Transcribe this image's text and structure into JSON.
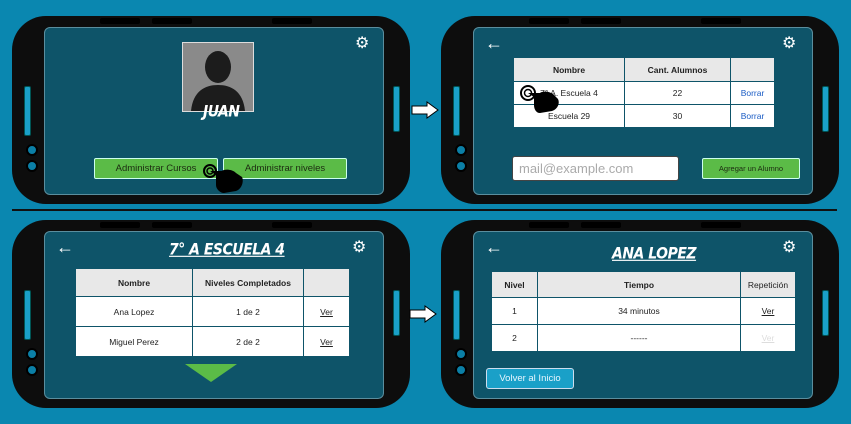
{
  "screen1": {
    "user_name": "JUAN",
    "btn_cursos": "Administrar Cursos",
    "btn_niveles": "Administrar niveles"
  },
  "screen2": {
    "headers": [
      "Nombre",
      "Cant. Alumnos",
      ""
    ],
    "rows": [
      {
        "nombre": "7° A. Escuela 4",
        "cant": "22",
        "accion": "Borrar"
      },
      {
        "nombre": "Escuela 29",
        "cant": "30",
        "accion": "Borrar"
      }
    ],
    "email_placeholder": "mail@example.com",
    "btn_agregar": "Agregar un Alumno"
  },
  "screen3": {
    "title": "7° A ESCUELA 4",
    "headers": [
      "Nombre",
      "Niveles Completados",
      ""
    ],
    "rows": [
      {
        "nombre": "Ana Lopez",
        "niveles": "1 de 2",
        "accion": "Ver"
      },
      {
        "nombre": "Miguel Perez",
        "niveles": "2 de 2",
        "accion": "Ver"
      }
    ]
  },
  "screen4": {
    "title": "ANA LOPEZ",
    "headers": [
      "Nivel",
      "Tiempo",
      "Repetición"
    ],
    "rows": [
      {
        "nivel": "1",
        "tiempo": "34 minutos",
        "accion": "Ver"
      },
      {
        "nivel": "2",
        "tiempo": "------",
        "accion": "Ver"
      }
    ],
    "btn_volver": "Volver al Inicio"
  },
  "icons": {
    "settings": "gear-icon",
    "back": "arrow-left-icon",
    "flow": "arrow-right-icon",
    "pointer": "hand-pointer-icon",
    "scroll": "triangle-down-icon"
  },
  "colors": {
    "background": "#0a87b0",
    "screen": "#0e5469",
    "accent_green": "#5bbb47",
    "accent_blue": "#1aa0c8"
  }
}
